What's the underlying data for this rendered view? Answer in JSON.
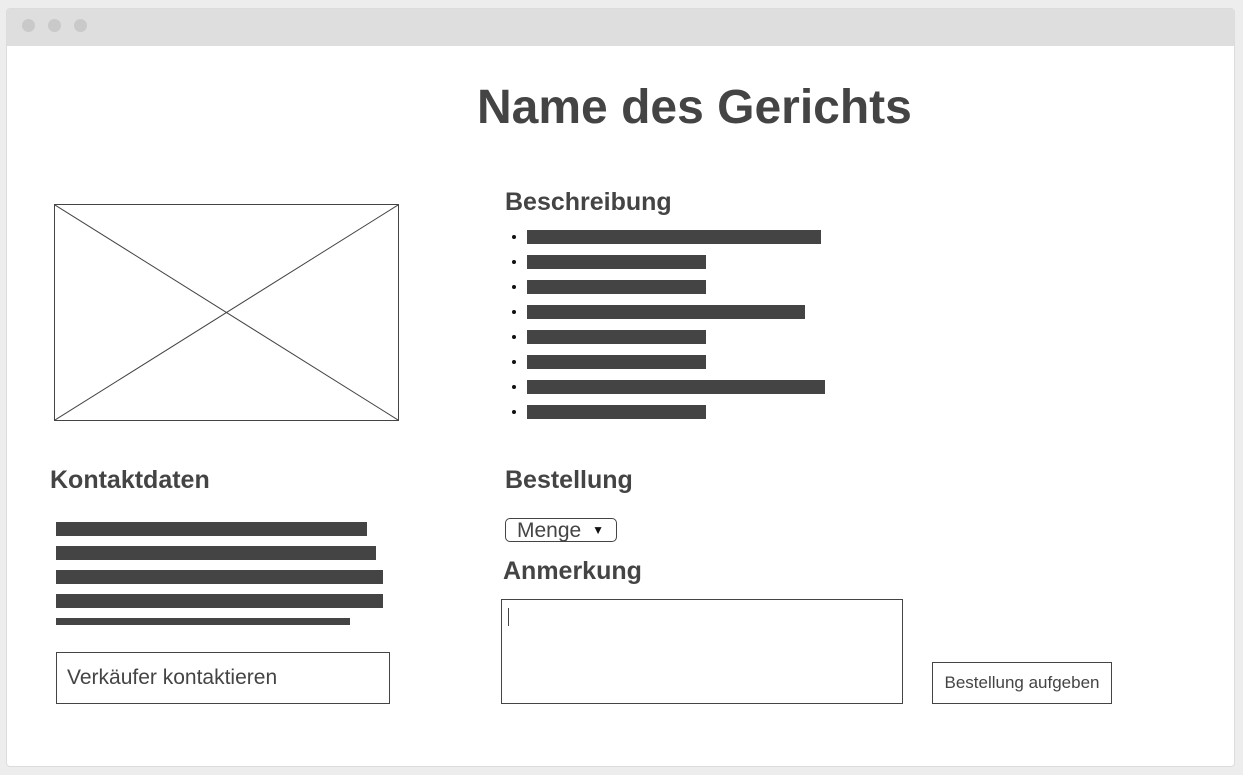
{
  "page": {
    "title": "Name des Gerichts"
  },
  "description": {
    "heading": "Beschreibung",
    "bullet_lines": [
      0.92,
      0.56,
      0.56,
      0.87,
      0.56,
      0.56,
      0.93,
      0.56
    ]
  },
  "image": {
    "icon": "image-placeholder-icon"
  },
  "contact": {
    "heading": "Kontaktdaten",
    "text_lines": [
      0.95,
      0.98,
      1.0,
      1.0,
      0.9
    ],
    "button_label": "Verkäufer kontaktieren"
  },
  "order": {
    "heading": "Bestellung",
    "quantity_select": {
      "selected": "Menge",
      "caret": "▼"
    },
    "note_heading": "Anmerkung",
    "note_value": "",
    "submit_label": "Bestellung aufgeben"
  },
  "colors": {
    "text": "#444444",
    "placeholder_bar": "#444444",
    "titlebar": "#dedede"
  }
}
